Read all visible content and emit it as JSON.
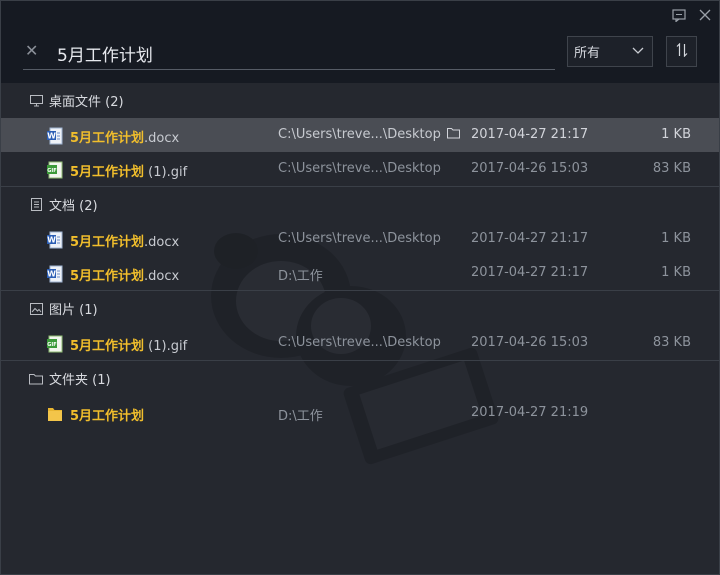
{
  "window": {
    "feedback_icon": "feedback-icon",
    "close_icon": "close-icon"
  },
  "search": {
    "value": "5月工作计划",
    "clear_icon": "clear-x-icon"
  },
  "filter": {
    "selected": "所有",
    "chevron_icon": "chevron-down-icon"
  },
  "sort": {
    "icon": "sort-arrows-icon"
  },
  "colors": {
    "highlight": "#f1be2c",
    "selected_row": "#4a4d54",
    "background": "#25282f"
  },
  "groups": [
    {
      "label": "桌面文件 (2)",
      "icon": "monitor-icon",
      "items": [
        {
          "name_highlight": "5月工作计划",
          "name_rest": ".docx",
          "type": "word",
          "path": "C:\\Users\\treve...\\Desktop",
          "date": "2017-04-27 21:17",
          "size": "1 KB",
          "selected": true
        },
        {
          "name_highlight": "5月工作计划",
          "name_rest": " (1).gif",
          "type": "image",
          "path": "C:\\Users\\treve...\\Desktop",
          "date": "2017-04-26 15:03",
          "size": "83 KB"
        }
      ]
    },
    {
      "label": "文档 (2)",
      "icon": "document-icon",
      "items": [
        {
          "name_highlight": "5月工作计划",
          "name_rest": ".docx",
          "type": "word",
          "path": "C:\\Users\\treve...\\Desktop",
          "date": "2017-04-27 21:17",
          "size": "1 KB"
        },
        {
          "name_highlight": "5月工作计划",
          "name_rest": ".docx",
          "type": "word",
          "path": "D:\\工作",
          "date": "2017-04-27 21:17",
          "size": "1 KB"
        }
      ]
    },
    {
      "label": "图片 (1)",
      "icon": "picture-icon",
      "items": [
        {
          "name_highlight": "5月工作计划",
          "name_rest": " (1).gif",
          "type": "image",
          "path": "C:\\Users\\treve...\\Desktop",
          "date": "2017-04-26 15:03",
          "size": "83 KB"
        }
      ]
    },
    {
      "label": "文件夹 (1)",
      "icon": "folder-outline-icon",
      "items": [
        {
          "name_highlight": "5月工作计划",
          "name_rest": "",
          "type": "folder",
          "path": "D:\\工作",
          "date": "2017-04-27 21:19",
          "size": ""
        }
      ]
    }
  ]
}
